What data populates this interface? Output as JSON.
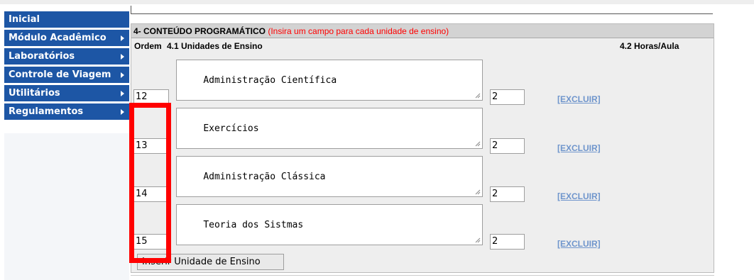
{
  "sidebar": {
    "items": [
      {
        "label": "Inicial",
        "has_arrow": false
      },
      {
        "label": "Módulo Acadêmico",
        "has_arrow": true
      },
      {
        "label": "Laboratórios",
        "has_arrow": true
      },
      {
        "label": "Controle de Viagem",
        "has_arrow": true
      },
      {
        "label": "Utilitários",
        "has_arrow": true
      },
      {
        "label": "Regulamentos",
        "has_arrow": true
      }
    ]
  },
  "section": {
    "title": "4- CONTEÚDO PROGRAMÁTICO",
    "hint": "(Insira um campo para cada unidade de ensino)",
    "col_ordem": "Ordem",
    "col_unidades": "4.1 Unidades de Ensino",
    "col_horas": "4.2 Horas/Aula"
  },
  "rows": [
    {
      "ordem": "12",
      "unidade": "Administração Científica",
      "horas": "2",
      "excluir": "[EXCLUIR]"
    },
    {
      "ordem": "13",
      "unidade": "Exercícios",
      "horas": "2",
      "excluir": "[EXCLUIR]"
    },
    {
      "ordem": "14",
      "unidade": "Administração Clássica",
      "horas": "2",
      "excluir": "[EXCLUIR]"
    },
    {
      "ordem": "15",
      "unidade": "Teoria dos Sistmas",
      "horas": "2",
      "excluir": "[EXCLUIR]"
    }
  ],
  "insert_button": {
    "label": "Inserir Unidade de Ensino"
  },
  "colors": {
    "nav_bg": "#1d56a5",
    "highlight": "#ff0000",
    "link": "#6f95cc",
    "hint": "#ff0000"
  }
}
